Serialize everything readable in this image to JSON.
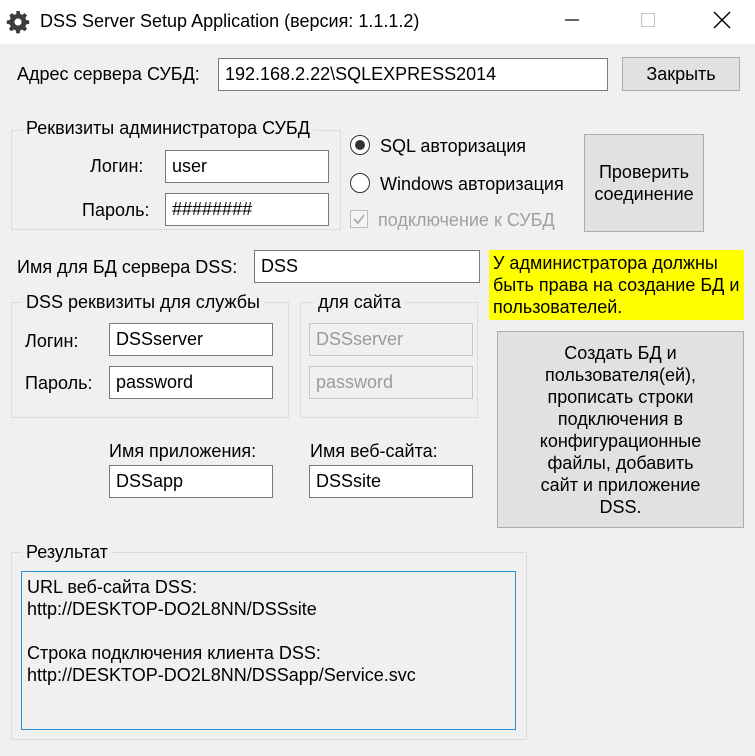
{
  "window": {
    "title": "DSS Server Setup Application (версия: 1.1.1.2)",
    "icons": {
      "app": "gear-icon",
      "minimize": "minimize-icon",
      "maximize": "maximize-icon",
      "close": "close-icon"
    }
  },
  "server": {
    "label": "Адрес сервера СУБД:",
    "value": "192.168.2.22\\SQLEXPRESS2014",
    "close_button": "Закрыть"
  },
  "admin": {
    "group_title": "Реквизиты администратора СУБД",
    "login_label": "Логин:",
    "login_value": "user",
    "password_label": "Пароль:",
    "password_value": "########"
  },
  "auth": {
    "sql_label": "SQL авторизация",
    "sql_selected": true,
    "windows_label": "Windows авторизация",
    "connect_label": "подключение к СУБД",
    "connect_checked": true,
    "check_button": "Проверить соединение"
  },
  "db": {
    "label": "Имя для БД сервера DSS:",
    "value": "DSS",
    "notice": "У администратора должны быть права на создание БД и пользователей."
  },
  "service": {
    "group_title": "DSS реквизиты для службы",
    "login_label": "Логин:",
    "login_value": "DSSserver",
    "password_label": "Пароль:",
    "password_value": "password"
  },
  "site": {
    "group_title": "для сайта",
    "login_value": "DSSserver",
    "password_value": "password"
  },
  "names": {
    "app_label": "Имя приложения:",
    "app_value": "DSSapp",
    "site_label": "Имя веб-сайта:",
    "site_value": "DSSsite"
  },
  "create_button": "Создать БД и пользователя(ей), прописать строки подключения в конфигурационные файлы, добавить сайт и приложение DSS.",
  "result": {
    "group_title": "Результат",
    "lines": [
      "URL веб-сайта DSS:",
      "http://DESKTOP-DO2L8NN/DSSsite",
      "",
      "Строка подключения клиента DSS:",
      "http://DESKTOP-DO2L8NN/DSSapp/Service.svc"
    ]
  }
}
